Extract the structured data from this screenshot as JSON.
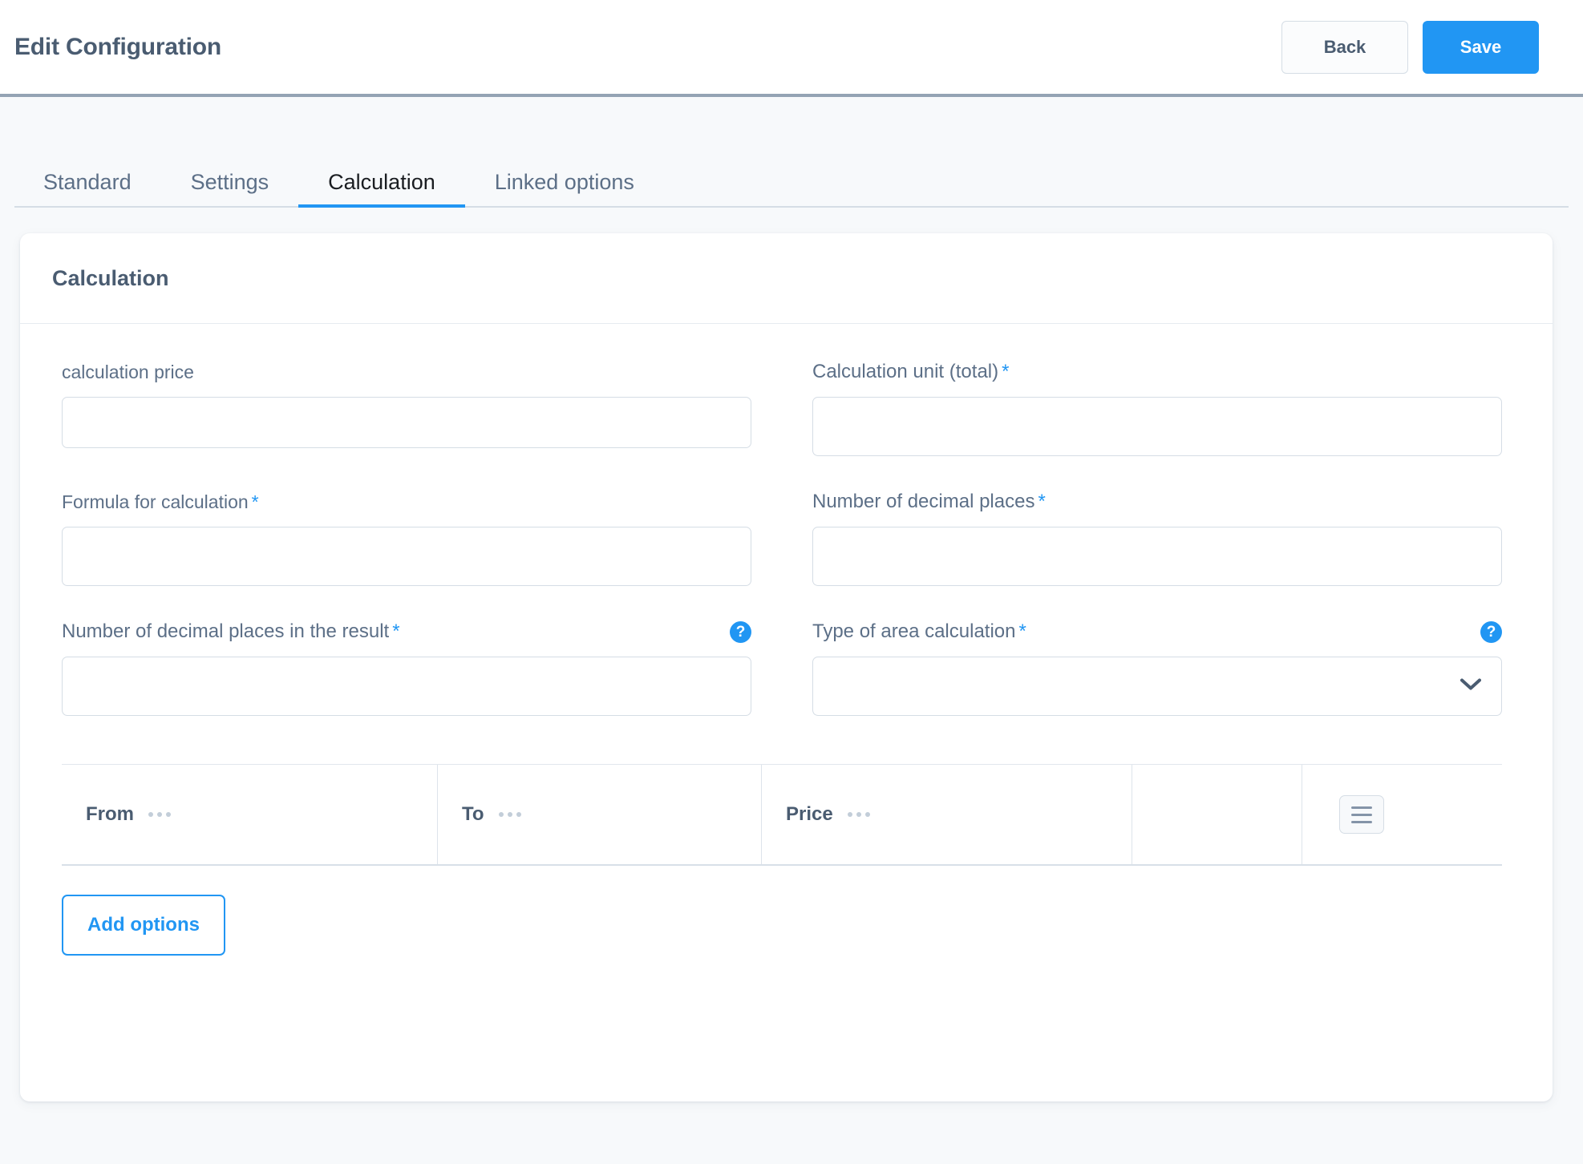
{
  "header": {
    "title": "Edit Configuration",
    "back_label": "Back",
    "save_label": "Save",
    "accent_color": "#2196f3",
    "title_color": "#4a5c71"
  },
  "tabs": [
    {
      "label": "Standard",
      "active": false
    },
    {
      "label": "Settings",
      "active": false
    },
    {
      "label": "Calculation",
      "active": true
    },
    {
      "label": "Linked options",
      "active": false
    }
  ],
  "card": {
    "title": "Calculation"
  },
  "fields": {
    "calculation_price": {
      "label": "calculation price",
      "required": "",
      "value": "",
      "placeholder": ""
    },
    "calculation_unit_total": {
      "label": "Calculation unit (total)",
      "required": "*",
      "value": "",
      "placeholder": ""
    },
    "formula_for_calculation": {
      "label": "Formula for calculation",
      "required": "*",
      "value": "",
      "placeholder": ""
    },
    "number_of_decimal_places": {
      "label": "Number of decimal places",
      "required": "*",
      "value": "",
      "placeholder": ""
    },
    "decimal_places_in_result": {
      "label": "Number of decimal places in the result",
      "required": "*",
      "value": "",
      "placeholder": "",
      "help": "?"
    },
    "type_of_area_calculation": {
      "label": "Type of area calculation",
      "required": "*",
      "value": "",
      "placeholder": "",
      "help": "?"
    }
  },
  "options_table": {
    "columns": [
      {
        "label": "From"
      },
      {
        "label": "To"
      },
      {
        "label": "Price"
      }
    ],
    "rows": [],
    "menu_icon": "hamburger-icon"
  },
  "actions": {
    "add_options_label": "Add options"
  }
}
